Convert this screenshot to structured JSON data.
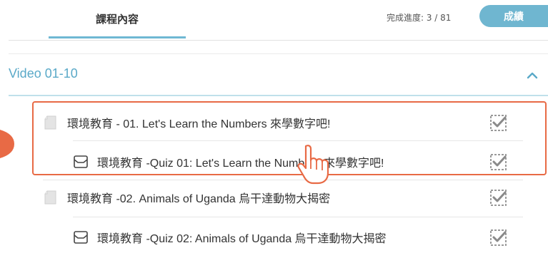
{
  "tabs": {
    "active_label": "課程內容"
  },
  "progress": {
    "label": "完成進度: 3 / 81"
  },
  "grade_button": {
    "label": "成績"
  },
  "section": {
    "title": "Video 01-10"
  },
  "items": [
    {
      "type": "document",
      "label": "環境教育 - 01. Let's Learn the Numbers 來學數字吧!"
    },
    {
      "type": "quiz",
      "label": "環境教育 -Quiz 01: Let's Learn the Numbers 來學數字吧!"
    },
    {
      "type": "document",
      "label": "環境教育 -02. Animals of Uganda 烏干達動物大揭密"
    },
    {
      "type": "quiz",
      "label": "環境教育 -Quiz 02: Animals of Uganda 烏干達動物大揭密"
    }
  ],
  "colors": {
    "accent": "#6fb6d0",
    "highlight": "#e86a45",
    "section_text": "#5aa9c8"
  },
  "icons": [
    "document-icon",
    "quiz-icon",
    "checkbox-checked-icon",
    "chevron-up-icon",
    "pointer-hand-icon"
  ]
}
